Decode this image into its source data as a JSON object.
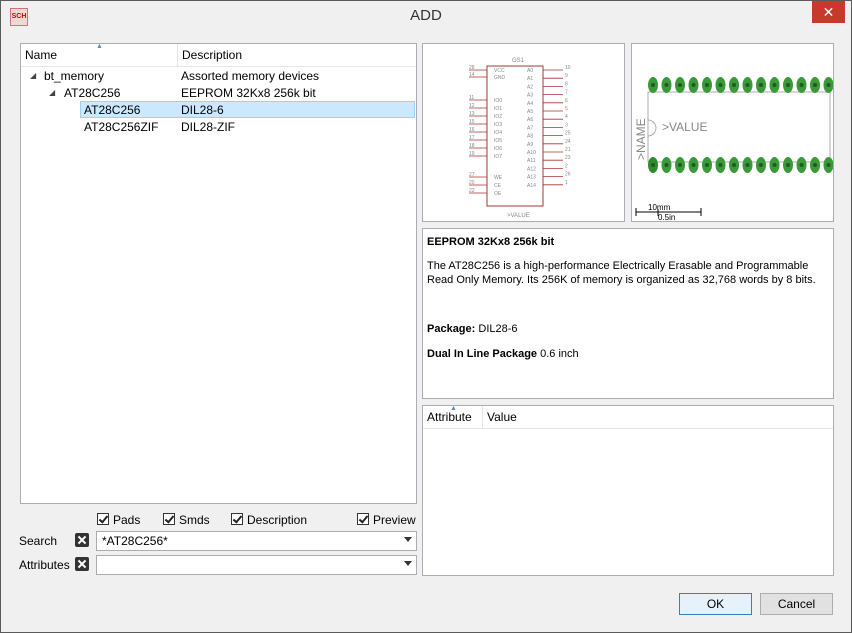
{
  "window": {
    "title": "ADD",
    "app_icon_text": "SCH",
    "close_glyph": "✕"
  },
  "tree": {
    "columns": [
      "Name",
      "Description"
    ],
    "rows": [
      {
        "name": "bt_memory",
        "description": "Assorted memory devices"
      },
      {
        "name": "AT28C256",
        "description": "EEPROM 32Kx8 256k bit"
      },
      {
        "name": "AT28C256",
        "description": "DIL28-6"
      },
      {
        "name": "AT28C256ZIF",
        "description": "DIL28-ZIF"
      }
    ]
  },
  "filters": {
    "pads": "Pads",
    "smds": "Smds",
    "description": "Description",
    "preview": "Preview"
  },
  "search": {
    "label": "Search",
    "value": "*AT28C256*"
  },
  "attributes_filter": {
    "label": "Attributes",
    "value": ""
  },
  "symbol": {
    "name_label": "GS1",
    "value_label": ">VALUE",
    "left_pins": [
      {
        "num": "28",
        "name": "VCC"
      },
      {
        "num": "14",
        "name": "GND"
      },
      {
        "num": "11",
        "name": "IO0"
      },
      {
        "num": "12",
        "name": "IO1"
      },
      {
        "num": "13",
        "name": "IO2"
      },
      {
        "num": "15",
        "name": "IO3"
      },
      {
        "num": "16",
        "name": "IO4"
      },
      {
        "num": "17",
        "name": "IO5"
      },
      {
        "num": "18",
        "name": "IO6"
      },
      {
        "num": "19",
        "name": "IO7"
      },
      {
        "num": "27",
        "name": "WE"
      },
      {
        "num": "20",
        "name": "CE"
      },
      {
        "num": "22",
        "name": "OE"
      }
    ],
    "right_pins": [
      {
        "num": "10",
        "name": "A0"
      },
      {
        "num": "9",
        "name": "A1"
      },
      {
        "num": "8",
        "name": "A2"
      },
      {
        "num": "7",
        "name": "A3"
      },
      {
        "num": "6",
        "name": "A4"
      },
      {
        "num": "5",
        "name": "A5"
      },
      {
        "num": "4",
        "name": "A6"
      },
      {
        "num": "3",
        "name": "A7"
      },
      {
        "num": "25",
        "name": "A8"
      },
      {
        "num": "24",
        "name": "A9"
      },
      {
        "num": "21",
        "name": "A10"
      },
      {
        "num": "23",
        "name": "A11"
      },
      {
        "num": "2",
        "name": "A12"
      },
      {
        "num": "26",
        "name": "A13"
      },
      {
        "num": "1",
        "name": "A14"
      }
    ]
  },
  "package_preview": {
    "value_label": ">VALUE",
    "name_label": ">NAME",
    "scale_mm": "10mm",
    "scale_in": "0.5in",
    "pads_per_row": 14
  },
  "info": {
    "title": "EEPROM 32Kx8 256k bit",
    "body": "The AT28C256 is a high-performance Electrically Erasable and Programmable Read Only Memory. Its 256K of memory is organized as 32,768 words by 8 bits.",
    "package_label": "Package:",
    "package_value": "DIL28-6",
    "package_desc_label": "Dual In Line Package",
    "package_desc_value": "0.6 inch"
  },
  "attributes_table": {
    "columns": [
      "Attribute",
      "Value"
    ]
  },
  "buttons": {
    "ok": "OK",
    "cancel": "Cancel"
  }
}
